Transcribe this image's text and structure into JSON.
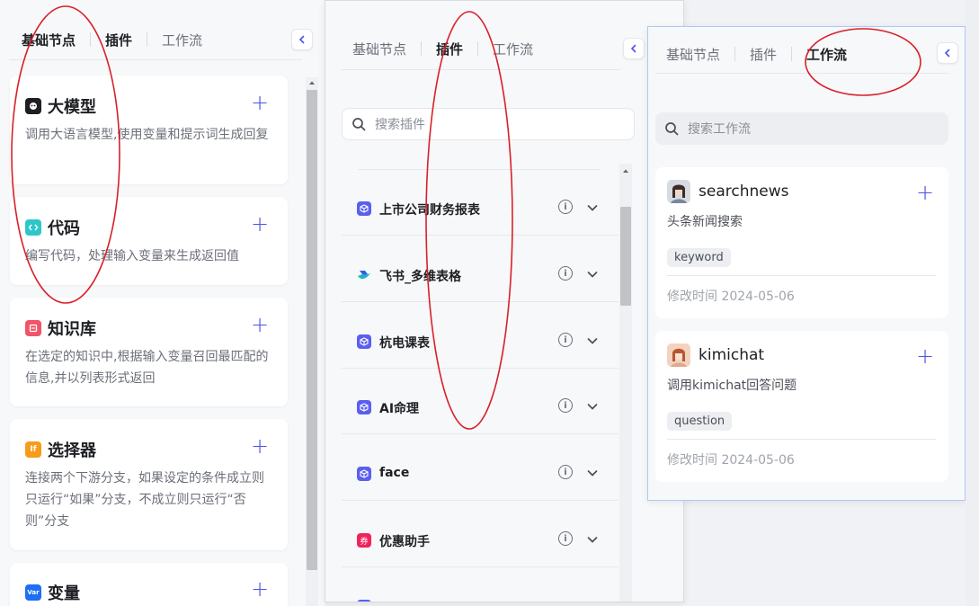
{
  "tabs": {
    "basic": "基础节点",
    "plugins": "插件",
    "workflow": "工作流"
  },
  "panel_basic": {
    "cards": [
      {
        "title": "大模型",
        "desc": "调用大语言模型,使用变量和提示词生成回复",
        "icon": "llm-icon",
        "color": "#1d1f23"
      },
      {
        "title": "代码",
        "desc": "编写代码，处理输入变量来生成返回值",
        "icon": "code-icon",
        "color": "#2ec7c9"
      },
      {
        "title": "知识库",
        "desc": "在选定的知识中,根据输入变量召回最匹配的信息,并以列表形式返回",
        "icon": "knowledge-icon",
        "color": "#f0546a"
      },
      {
        "title": "选择器",
        "desc": "连接两个下游分支，如果设定的条件成立则只运行“如果”分支，不成立则只运行“否则”分支",
        "icon": "condition-icon",
        "color": "#f79b1b"
      },
      {
        "title": "变量",
        "desc": "",
        "icon": "variable-icon",
        "color": "#1e6ff5"
      }
    ]
  },
  "panel_plugins": {
    "search_placeholder": "搜索插件",
    "items": [
      {
        "name": "上市公司财务报表",
        "icon": "cube-icon",
        "color": "#5a5ff0"
      },
      {
        "name": "飞书_多维表格",
        "icon": "feishu-icon",
        "color": "#1fb4c4"
      },
      {
        "name": "杭电课表",
        "icon": "cube-icon",
        "color": "#5a5ff0"
      },
      {
        "name": "AI命理",
        "icon": "cube-icon",
        "color": "#5a5ff0"
      },
      {
        "name": "face",
        "icon": "cube-icon",
        "color": "#5a5ff0"
      },
      {
        "name": "优惠助手",
        "icon": "coupon-icon",
        "color": "#f0245c"
      }
    ]
  },
  "panel_workflow": {
    "search_placeholder": "搜索工作流",
    "items": [
      {
        "name": "searchnews",
        "desc": "头条新闻搜索",
        "tag": "keyword",
        "time": "修改时间 2024-05-06"
      },
      {
        "name": "kimichat",
        "desc": "调用kimichat回答问题",
        "tag": "question",
        "time": "修改时间 2024-05-06"
      }
    ]
  },
  "annotation_color": "#d9202a"
}
